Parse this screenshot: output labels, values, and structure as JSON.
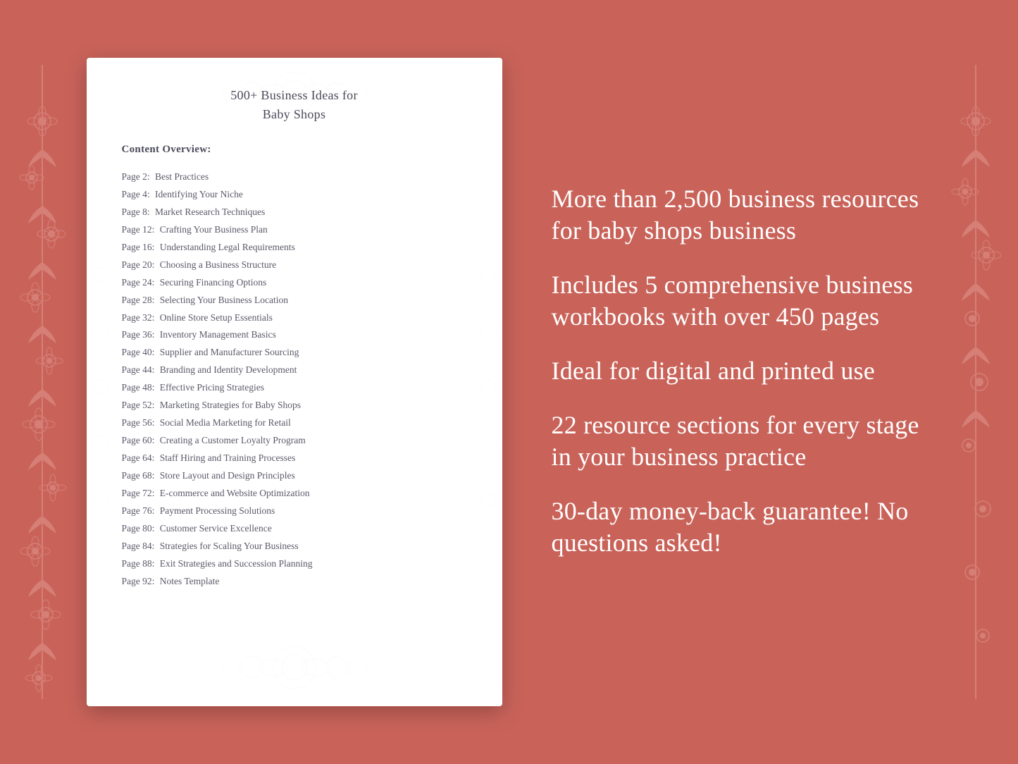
{
  "background_color": "#c9635a",
  "document": {
    "title_line1": "500+ Business Ideas for",
    "title_line2": "Baby Shops",
    "content_overview_label": "Content Overview:",
    "toc_items": [
      {
        "page": "Page  2:",
        "topic": "Best Practices"
      },
      {
        "page": "Page  4:",
        "topic": "Identifying Your Niche"
      },
      {
        "page": "Page  8:",
        "topic": "Market Research Techniques"
      },
      {
        "page": "Page 12:",
        "topic": "Crafting Your Business Plan"
      },
      {
        "page": "Page 16:",
        "topic": "Understanding Legal Requirements"
      },
      {
        "page": "Page 20:",
        "topic": "Choosing a Business Structure"
      },
      {
        "page": "Page 24:",
        "topic": "Securing Financing Options"
      },
      {
        "page": "Page 28:",
        "topic": "Selecting Your Business Location"
      },
      {
        "page": "Page 32:",
        "topic": "Online Store Setup Essentials"
      },
      {
        "page": "Page 36:",
        "topic": "Inventory Management Basics"
      },
      {
        "page": "Page 40:",
        "topic": "Supplier and Manufacturer Sourcing"
      },
      {
        "page": "Page 44:",
        "topic": "Branding and Identity Development"
      },
      {
        "page": "Page 48:",
        "topic": "Effective Pricing Strategies"
      },
      {
        "page": "Page 52:",
        "topic": "Marketing Strategies for Baby Shops"
      },
      {
        "page": "Page 56:",
        "topic": "Social Media Marketing for Retail"
      },
      {
        "page": "Page 60:",
        "topic": "Creating a Customer Loyalty Program"
      },
      {
        "page": "Page 64:",
        "topic": "Staff Hiring and Training Processes"
      },
      {
        "page": "Page 68:",
        "topic": "Store Layout and Design Principles"
      },
      {
        "page": "Page 72:",
        "topic": "E-commerce and Website Optimization"
      },
      {
        "page": "Page 76:",
        "topic": "Payment Processing Solutions"
      },
      {
        "page": "Page 80:",
        "topic": "Customer Service Excellence"
      },
      {
        "page": "Page 84:",
        "topic": "Strategies for Scaling Your Business"
      },
      {
        "page": "Page 88:",
        "topic": "Exit Strategies and Succession Planning"
      },
      {
        "page": "Page 92:",
        "topic": "Notes Template"
      }
    ]
  },
  "features": [
    {
      "text": "More than 2,500 business resources for baby shops business"
    },
    {
      "text": "Includes 5 comprehensive business workbooks with over 450 pages"
    },
    {
      "text": "Ideal for digital and printed use"
    },
    {
      "text": "22 resource sections for every stage in your business practice"
    },
    {
      "text": "30-day money-back guarantee! No questions asked!"
    }
  ]
}
